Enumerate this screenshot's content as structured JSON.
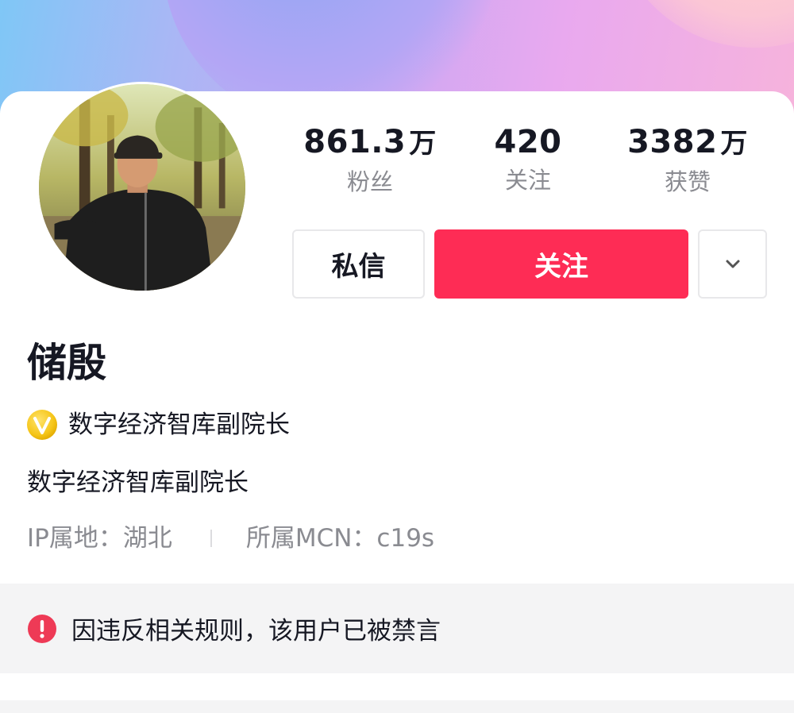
{
  "profile": {
    "name": "储殷",
    "verification": "数字经济智库副院长",
    "bio": "数字经济智库副院长",
    "ip_label": "IP属地：湖北",
    "mcn_label": "所属MCN：c19s"
  },
  "stats": {
    "fans": {
      "value": "861.3",
      "unit": "万",
      "label": "粉丝"
    },
    "following": {
      "value": "420",
      "unit": "",
      "label": "关注"
    },
    "likes": {
      "value": "3382",
      "unit": "万",
      "label": "获赞"
    }
  },
  "actions": {
    "message_label": "私信",
    "follow_label": "关注"
  },
  "notice": {
    "text": "因违反相关规则，该用户已被禁言"
  },
  "colors": {
    "follow_button": "#fe2c55",
    "text_primary": "#161823",
    "text_secondary": "#8a8b91",
    "notice_bg": "#f4f4f5",
    "verify_badge": "#f5c518",
    "notice_icon": "#ee3a56"
  },
  "icons": {
    "verify": "verified-v-badge-icon",
    "more": "chevron-down-icon",
    "notice": "exclamation-circle-icon"
  }
}
